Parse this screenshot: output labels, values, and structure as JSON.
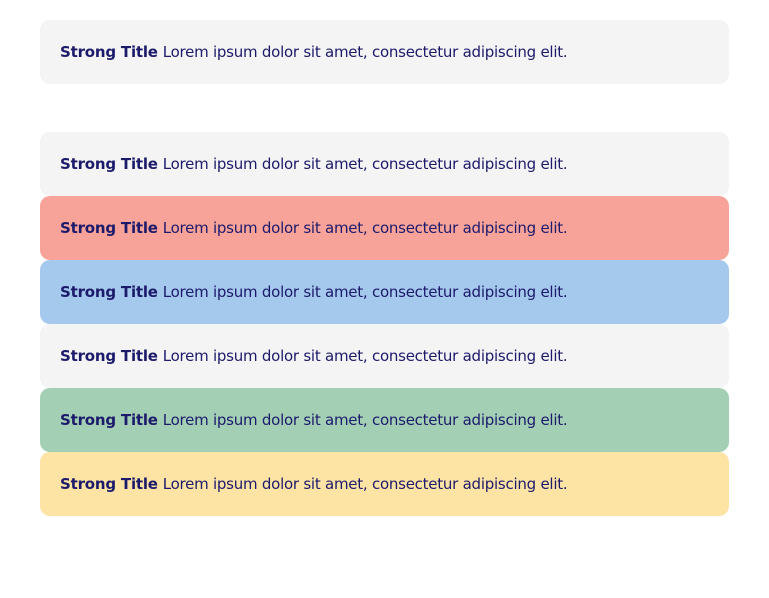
{
  "alerts": [
    {
      "title": "Strong Title",
      "message": "Lorem ipsum dolor sit amet, consectetur adipiscing elit.",
      "variant": "neutral",
      "color": "#f4f4f4"
    },
    {
      "title": "Strong Title",
      "message": "Lorem ipsum dolor sit amet, consectetur adipiscing elit.",
      "variant": "neutral",
      "color": "#f4f4f4"
    },
    {
      "title": "Strong Title",
      "message": "Lorem ipsum dolor sit amet, consectetur adipiscing elit.",
      "variant": "danger",
      "color": "#f7a39a"
    },
    {
      "title": "Strong Title",
      "message": "Lorem ipsum dolor sit amet, consectetur adipiscing elit.",
      "variant": "info",
      "color": "#a5c8ed"
    },
    {
      "title": "Strong Title",
      "message": "Lorem ipsum dolor sit amet, consectetur adipiscing elit.",
      "variant": "neutral",
      "color": "#f4f4f4"
    },
    {
      "title": "Strong Title",
      "message": "Lorem ipsum dolor sit amet, consectetur adipiscing elit.",
      "variant": "success",
      "color": "#a3d0b4"
    },
    {
      "title": "Strong Title",
      "message": "Lorem ipsum dolor sit amet, consectetur adipiscing elit.",
      "variant": "warning",
      "color": "#fde3a4"
    }
  ],
  "text_color": "#1c1a6b"
}
